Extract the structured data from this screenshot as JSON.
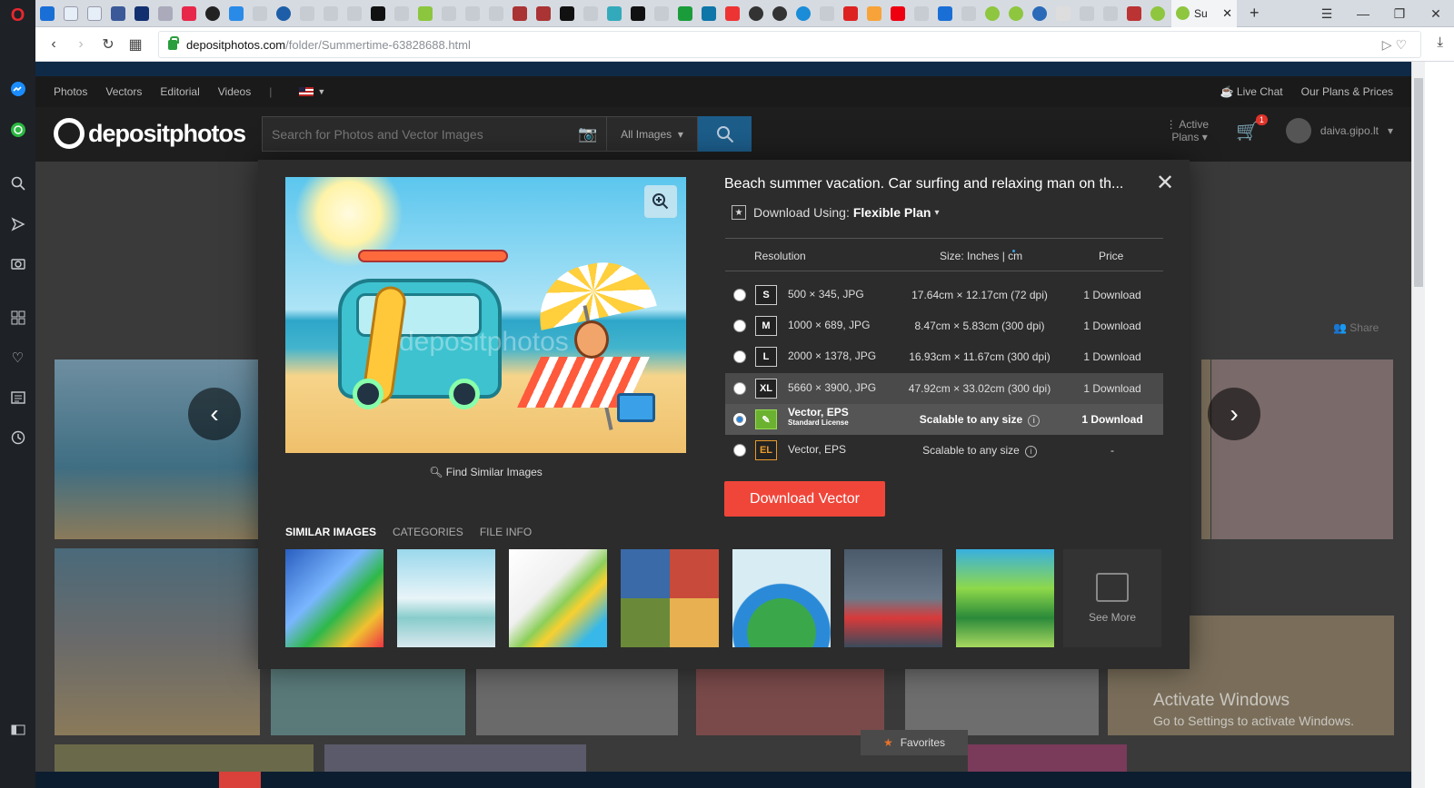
{
  "browser": {
    "active_tab_label": "Su",
    "url_domain": "depositphotos.com",
    "url_path": "/folder/Summertime-63828688.html",
    "window_controls": {
      "minimize": "—",
      "restore": "❐",
      "close": "✕"
    }
  },
  "opera_sidebar": {
    "icons": [
      "opera-logo-icon",
      "messenger-icon",
      "whatsapp-icon",
      "search-icon",
      "send-icon",
      "camera-icon",
      "grid-icon",
      "heart-icon",
      "news-icon",
      "history-icon",
      "sidebar-toggle-icon"
    ]
  },
  "site": {
    "topnav": [
      "Photos",
      "Vectors",
      "Editorial",
      "Videos"
    ],
    "live_chat": "Live Chat",
    "our_plans": "Our Plans & Prices",
    "logo_text": "depositphotos",
    "search_placeholder": "Search for Photos and Vector Images",
    "search_filter": "All Images",
    "active_plans_line1": "Active",
    "active_plans_line2": "Plans",
    "cart_count": "1",
    "username": "daiva.gipo.lt",
    "share_label": "Share",
    "favorites_label": "Favorites"
  },
  "modal": {
    "title": "Beach summer vacation. Car surfing and relaxing man on th...",
    "download_using_prefix": "Download Using:",
    "plan_name": "Flexible Plan",
    "watermark": "depositphotos",
    "find_similar": "Find Similar Images",
    "table_headers": {
      "resolution": "Resolution",
      "size": "Size: Inches | cm",
      "price": "Price"
    },
    "rows": [
      {
        "badge": "S",
        "resolution": "500 × 345, JPG",
        "size": "17.64cm × 12.17cm (72 dpi)",
        "price": "1 Download"
      },
      {
        "badge": "M",
        "resolution": "1000 × 689, JPG",
        "size": "8.47cm × 5.83cm (300 dpi)",
        "price": "1 Download"
      },
      {
        "badge": "L",
        "resolution": "2000 × 1378, JPG",
        "size": "16.93cm × 11.67cm (300 dpi)",
        "price": "1 Download"
      },
      {
        "badge": "XL",
        "resolution": "5660 × 3900, JPG",
        "size": "47.92cm × 33.02cm (300 dpi)",
        "price": "1 Download"
      },
      {
        "badge": "✎",
        "resolution": "Vector, EPS",
        "license": "Standard License",
        "size": "Scalable to any size",
        "price": "1 Download"
      },
      {
        "badge": "EL",
        "resolution": "Vector, EPS",
        "size": "Scalable to any size",
        "price": "-"
      }
    ],
    "download_button": "Download Vector",
    "tabs": [
      "SIMILAR IMAGES",
      "CATEGORIES",
      "FILE INFO"
    ],
    "see_more": "See More",
    "similar_colors": [
      "#3a7fd6",
      "#6cc3d8",
      "#f0f0f0",
      "#b84a3a",
      "#8ec8e8",
      "#4a5a6a",
      "#58b848"
    ]
  },
  "overlay": {
    "activate_title": "Activate Windows",
    "activate_sub": "Go to Settings to activate Windows."
  }
}
